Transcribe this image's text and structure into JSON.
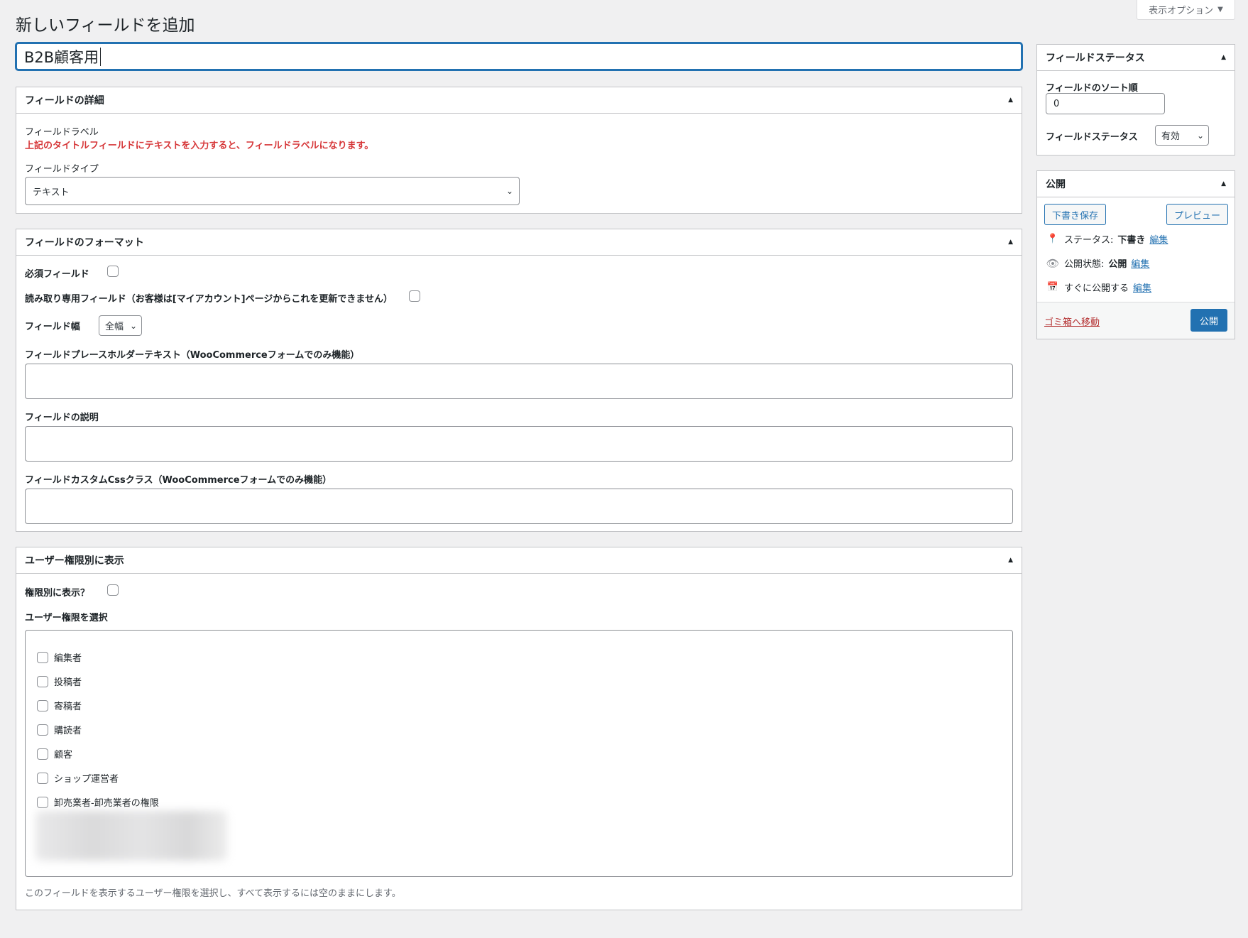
{
  "screen_options": {
    "label": "表示オプション",
    "arrow": "▼"
  },
  "page_title": "新しいフィールドを追加",
  "title_input": {
    "value": "B2B顧客用"
  },
  "details_box": {
    "title": "フィールドの詳細",
    "field_label_caption": "フィールドラベル",
    "field_label_note": "上記のタイトルフィールドにテキストを入力すると、フィールドラベルになります。",
    "field_type_caption": "フィールドタイプ",
    "field_type_value": "テキスト"
  },
  "format_box": {
    "title": "フィールドのフォーマット",
    "required_label": "必須フィールド",
    "readonly_label": "読み取り専用フィールド（お客様は[マイアカウント]ページからこれを更新できません）",
    "width_label": "フィールド幅",
    "width_value": "全幅",
    "placeholder_label": "フィールドプレースホルダーテキスト（WooCommerceフォームでのみ機能）",
    "description_label": "フィールドの説明",
    "css_label": "フィールドカスタムCssクラス（WooCommerceフォームでのみ機能）"
  },
  "roles_box": {
    "title": "ユーザー権限別に表示",
    "show_by_role_label": "権限別に表示？",
    "select_roles_label": "ユーザー権限を選択",
    "roles": [
      "編集者",
      "投稿者",
      "寄稿者",
      "購読者",
      "顧客",
      "ショップ運営者",
      "卸売業者-卸売業者の権限"
    ],
    "help": "このフィールドを表示するユーザー権限を選択し、すべて表示するには空のままにします。"
  },
  "status_box": {
    "title": "フィールドステータス",
    "sort_label": "フィールドのソート順",
    "sort_value": "0",
    "status_label": "フィールドステータス",
    "status_value": "有効"
  },
  "publish_box": {
    "title": "公開",
    "save_draft": "下書き保存",
    "preview": "プレビュー",
    "status_prefix": "ステータス:",
    "status_value": "下書き",
    "visibility_prefix": "公開状態:",
    "visibility_value": "公開",
    "schedule_text": "すぐに公開する",
    "edit_link": "編集",
    "trash": "ゴミ箱へ移動",
    "publish": "公開"
  },
  "icons": {
    "toggle": "▲",
    "chevron": "⌄",
    "pin": "📍",
    "eye": "👁",
    "calendar": "📅"
  },
  "colors": {
    "accent": "#2271b1",
    "warning": "#d63638",
    "trash": "#b32d2e"
  }
}
